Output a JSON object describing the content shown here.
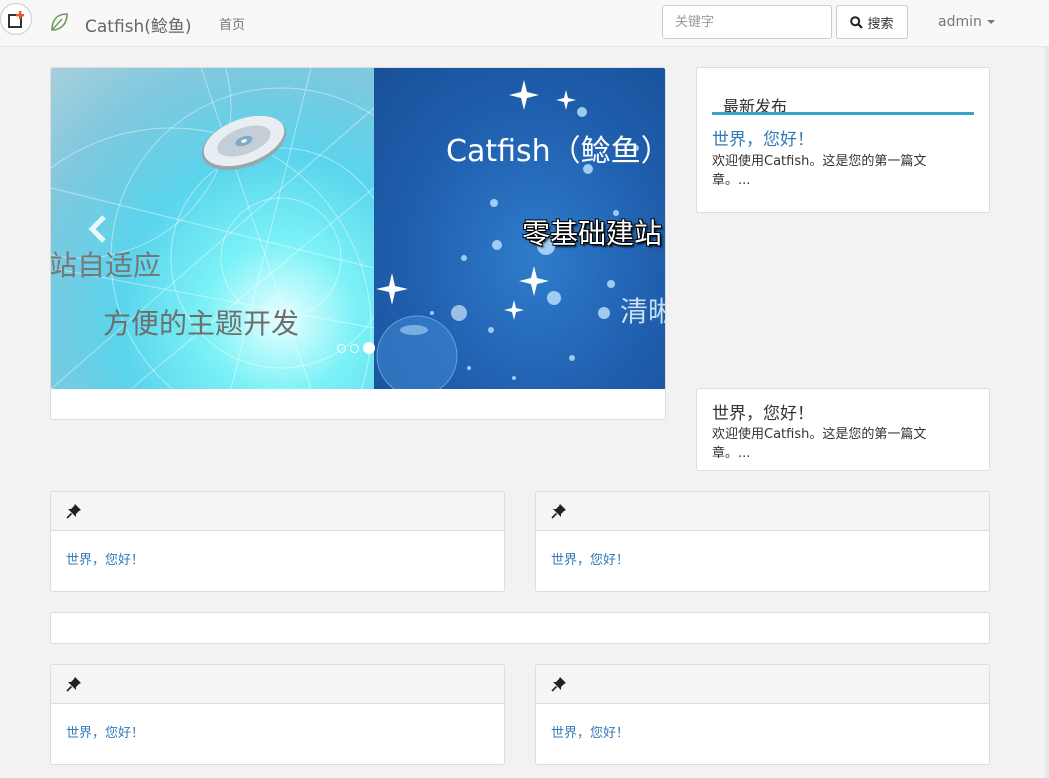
{
  "navbar": {
    "brand": "Catfish(鲶鱼)",
    "home": "首页",
    "search_placeholder": "关键字",
    "search_button": "搜索",
    "user": "admin"
  },
  "carousel": {
    "slide_left_lines": [
      "站自适应",
      "方便的主题开发"
    ],
    "slide_right_lines": [
      "Catfish（鲶鱼）",
      "零基础建站",
      "清晰"
    ],
    "slide_count": 3,
    "active_slide": 3
  },
  "latest": {
    "title": "最新发布",
    "post_title": "世界，您好！",
    "excerpt": "欢迎使用Catfish。这是您的第一篇文章。..."
  },
  "side_post": {
    "title": "世界，您好！",
    "excerpt": "欢迎使用Catfish。这是您的第一篇文章。..."
  },
  "cards": [
    {
      "link": "世界，您好！"
    },
    {
      "link": "世界，您好！"
    },
    {
      "link": "世界，您好！"
    },
    {
      "link": "世界，您好！"
    }
  ],
  "colors": {
    "link": "#337ab7",
    "accent_line": "#3aa3c9",
    "page_bg": "#f2f2f2"
  },
  "icons": [
    "plus-square-icon",
    "leaf-icon",
    "search-icon",
    "chevron-left-icon",
    "pushpin-icon",
    "caret-down-icon"
  ]
}
